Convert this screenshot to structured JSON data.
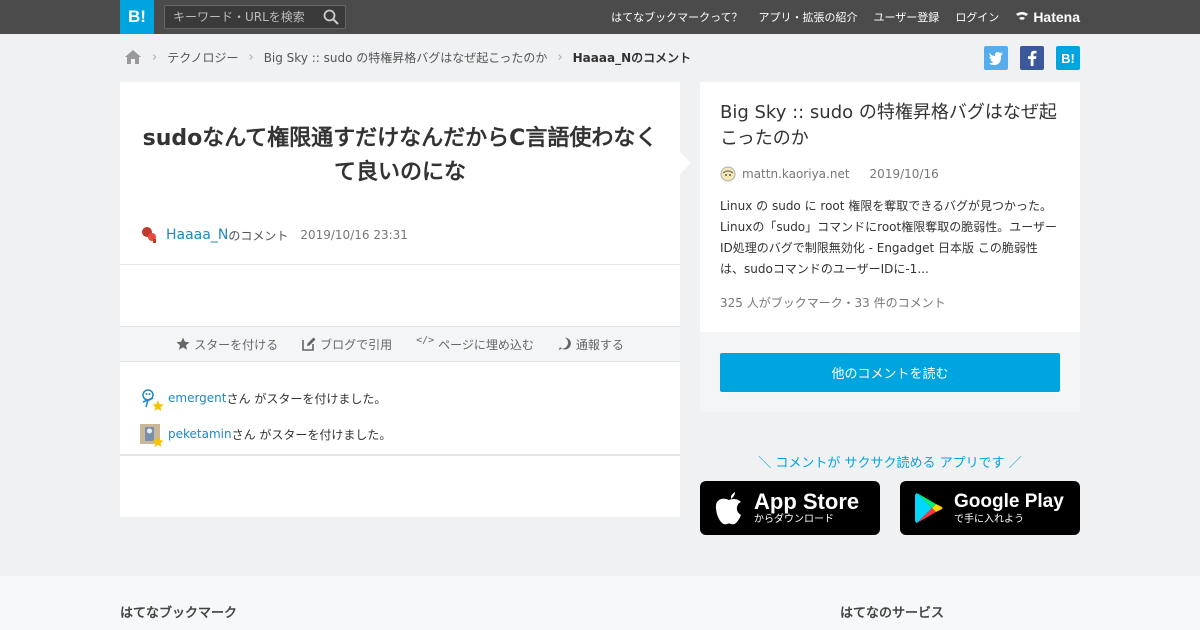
{
  "header": {
    "logo": "B!",
    "search_placeholder": "キーワード・URLを検索",
    "nav": [
      "はてなブックマークって？",
      "アプリ・拡張の紹介",
      "ユーザー登録",
      "ログイン"
    ],
    "brand": "Hatena"
  },
  "breadcrumb": {
    "items": [
      "テクノロジー",
      "Big Sky :: sudo の特権昇格バグはなぜ起こったのか"
    ],
    "current": "Haaaa_Nのコメント"
  },
  "share": {
    "bookmark": "B!"
  },
  "comment": {
    "text": "sudoなんて権限通すだけなんだからC言語使わなくて良いのにな",
    "user": "Haaaa_N",
    "suffix": "のコメント",
    "timestamp": "2019/10/16 23:31"
  },
  "actions": [
    "スターを付ける",
    "ブログで引用",
    "ページに埋め込む",
    "通報する"
  ],
  "stars": [
    {
      "user": "emergent",
      "text": "さん がスターを付けました。"
    },
    {
      "user": "peketamin",
      "text": "さん がスターを付けました。"
    }
  ],
  "entry": {
    "title": "Big Sky :: sudo の特権昇格バグはなぜ起こったのか",
    "domain": "mattn.kaoriya.net",
    "date": "2019/10/16",
    "description": "Linux の sudo に root 権限を奪取できるバグが見つかった。 Linuxの「sudo」コマンドにroot権限奪取の脆弱性。ユーザーID処理のバグで制限無効化 - Engadget 日本版 この脆弱性は、sudoコマンドのユーザーIDに-1...",
    "stats": "325 人がブックマーク・33 件のコメント",
    "read_button": "他のコメントを読む"
  },
  "promo": {
    "text": "＼ コメントが サクサク読める アプリです ／",
    "appstore_big": "App Store",
    "appstore_small": "からダウンロード",
    "googleplay_big": "Google Play",
    "googleplay_small": "で手に入れよう"
  },
  "footer": {
    "left": "はてなブックマーク",
    "right": "はてなのサービス"
  },
  "colors": {
    "accent": "#00a4de",
    "header": "#4b4b4b",
    "link": "#1e88c7"
  }
}
